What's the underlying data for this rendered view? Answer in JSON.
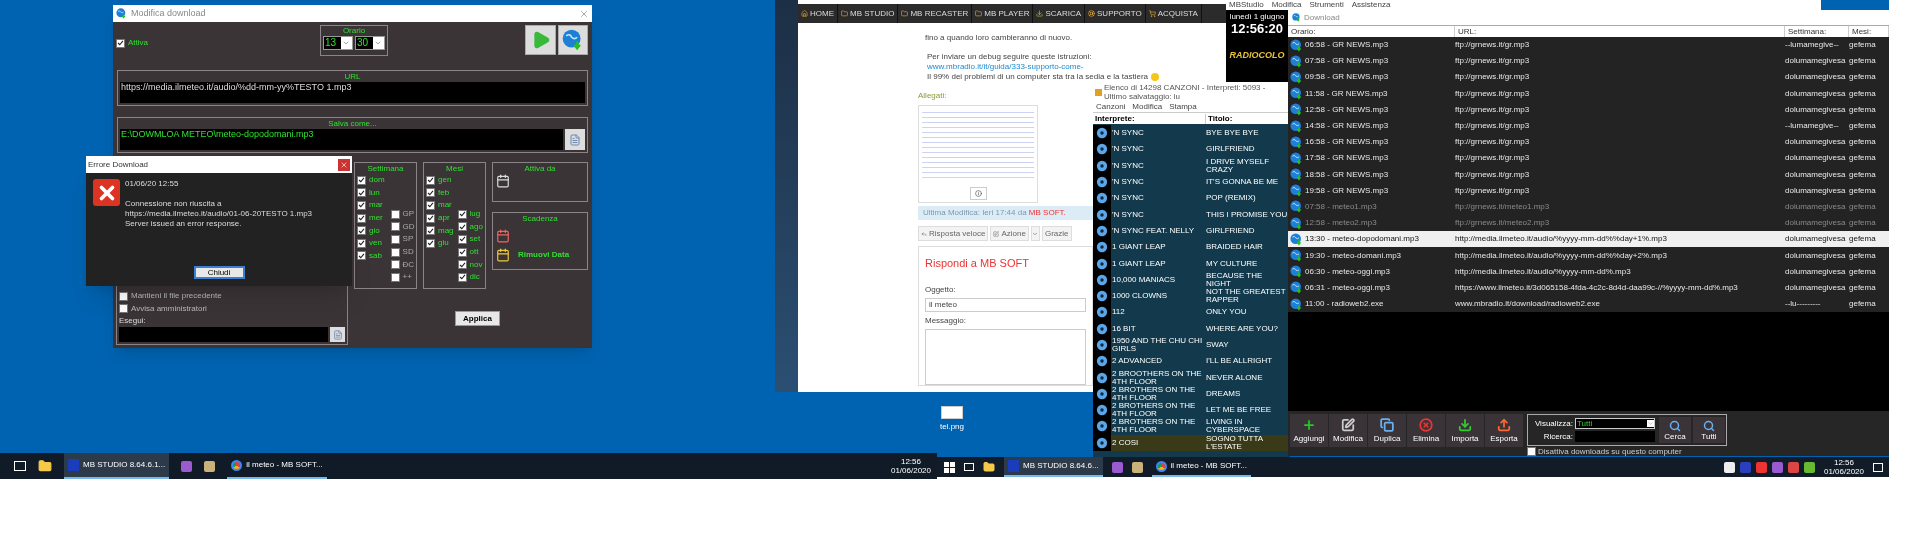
{
  "edit_dialog": {
    "title": "Modifica download",
    "active": {
      "label": "Attiva",
      "checked": true
    },
    "schedule": {
      "label": "Orario",
      "hour": "13",
      "minute": "30"
    },
    "url": {
      "label": "URL",
      "value": "https://media.ilmeteo.it/audio/%dd-mm-yy%TESTO 1.mp3"
    },
    "save_as": {
      "label": "Salva come...",
      "value": "E:\\DOWMLOA METEO\\meteo-dopodomani.mp3"
    },
    "failure_options": [
      {
        "label": "Mantieni il file precedente",
        "checked": false
      },
      {
        "label": "Avvisa amministratori",
        "checked": false
      }
    ],
    "run_label": "Esegui:",
    "week": {
      "label": "Settimana",
      "days": [
        {
          "label": "dom",
          "checked": true
        },
        {
          "label": "lun",
          "checked": true
        },
        {
          "label": "mar",
          "checked": true
        },
        {
          "label": "mer",
          "checked": true
        },
        {
          "label": "gio",
          "checked": true
        },
        {
          "label": "ven",
          "checked": true
        },
        {
          "label": "sab",
          "checked": true
        }
      ],
      "special": [
        {
          "label": "GP",
          "checked": false
        },
        {
          "label": "GD",
          "checked": false
        },
        {
          "label": "SP",
          "checked": false
        },
        {
          "label": "SD",
          "checked": false
        },
        {
          "label": "ÐC",
          "checked": false
        },
        {
          "label": "++",
          "checked": false
        }
      ]
    },
    "months": {
      "label": "Mesi",
      "items": [
        {
          "label": "gen",
          "checked": true
        },
        {
          "label": "feb",
          "checked": true
        },
        {
          "label": "mar",
          "checked": true
        },
        {
          "label": "apr",
          "checked": true
        },
        {
          "label": "mag",
          "checked": true
        },
        {
          "label": "giu",
          "checked": true
        },
        {
          "label": "lug",
          "checked": true
        },
        {
          "label": "ago",
          "checked": true
        },
        {
          "label": "set",
          "checked": true
        },
        {
          "label": "ott",
          "checked": true
        },
        {
          "label": "nov",
          "checked": true
        },
        {
          "label": "dic",
          "checked": true
        }
      ]
    },
    "active_from": {
      "label": "Attiva da"
    },
    "expiry": {
      "label": "Scadenza",
      "remove": "Rimuovi Data"
    },
    "apply": "Applica"
  },
  "error_dialog": {
    "title": "Errore Download",
    "timestamp": "01/06/20 12:55",
    "message": [
      "Connessione non riuscita a",
      "https://media.ilmeteo.it/audio/01-06-20TESTO 1.mp3",
      "Server issued an error response."
    ],
    "button": "Chiudi"
  },
  "left_taskbar": {
    "tasks": [
      {
        "label": "MB STUDIO 8.64.6.1...",
        "selected": true
      },
      {
        "label": "il meteo - MB SOFT...",
        "selected": false
      }
    ],
    "clock": {
      "time": "12:56",
      "date": "01/06/2020"
    }
  },
  "forum_page": {
    "nav": [
      "HOME",
      "MB STUDIO",
      "MB RECASTER",
      "MB PLAYER",
      "SCARICA",
      "SUPPORTO",
      "ACQUISTA"
    ],
    "post_text": "fino a quando loro cambieranno di nuovo.",
    "debug_text": "Per inviare un debug seguire queste istruzioni:",
    "debug_link": "www.mbradio.it/it/guida/333-supporto-come-",
    "signature": "Il 99% dei problemi di un computer sta tra la sedia e la tastiera",
    "attachments_label": "Allegati:",
    "last_edit": "Ultima Modifica: Ieri 17:44 da",
    "last_edit_author": "MB SOFT.",
    "actions": [
      "Risposta veloce",
      "Azione",
      "Grazie"
    ],
    "reply_title": "Rispondi a",
    "reply_author": "MB SOFT",
    "subject_label": "Oggetto:",
    "subject_value": "il meteo",
    "message_label": "Messaggio:"
  },
  "desktop_icon": {
    "label": "tel.png"
  },
  "studio_panel": {
    "menu": [
      "MBStudio",
      "Modifica",
      "Strumenti",
      "Assistenza"
    ],
    "date": "lunedì 1 giugno",
    "time": "12:56:20",
    "logo": "RADIOCOLO"
  },
  "song_list": {
    "title": "Elenco di 14298 CANZONI - Interpreti: 5093 - Ultimo salvataggio: lu",
    "menu": [
      "Canzoni",
      "Modifica",
      "Stampa"
    ],
    "columns": [
      "Interprete:",
      "Titolo:"
    ],
    "rows": [
      {
        "artist": "'N SYNC",
        "title": "BYE BYE BYE",
        "selected": false
      },
      {
        "artist": "'N SYNC",
        "title": "GIRLFRIEND",
        "selected": false
      },
      {
        "artist": "'N SYNC",
        "title": "I DRIVE MYSELF CRAZY",
        "selected": false
      },
      {
        "artist": "'N SYNC",
        "title": "IT'S GONNA BE ME",
        "selected": false
      },
      {
        "artist": "'N SYNC",
        "title": "POP          (REMIX)",
        "selected": false
      },
      {
        "artist": "'N SYNC",
        "title": "THIS I PROMISE YOU",
        "selected": false
      },
      {
        "artist": "'N SYNC FEAT. NELLY",
        "title": "GIRLFRIEND",
        "selected": false
      },
      {
        "artist": "1 GIANT LEAP",
        "title": "BRAIDED HAIR",
        "selected": false
      },
      {
        "artist": "1 GIANT LEAP",
        "title": "MY CULTURE",
        "selected": false
      },
      {
        "artist": "10,000 MANIACS",
        "title": "BECAUSE THE NIGHT",
        "selected": false
      },
      {
        "artist": "1000 CLOWNS",
        "title": "NOT THE GREATEST RAPPER",
        "selected": false
      },
      {
        "artist": "112",
        "title": "ONLY YOU",
        "selected": false
      },
      {
        "artist": "16 BIT",
        "title": "WHERE ARE YOU?",
        "selected": false
      },
      {
        "artist": "1950 AND THE CHU CHI GIRLS",
        "title": "SWAY",
        "selected": false
      },
      {
        "artist": "2 ADVANCED",
        "title": "I'LL BE ALLRIGHT",
        "selected": false
      },
      {
        "artist": "2 BROOTHERS ON THE 4TH FLOOR",
        "title": "NEVER ALONE",
        "selected": false
      },
      {
        "artist": "2 BROTHERS ON THE 4TH FLOOR",
        "title": "DREAMS",
        "selected": false
      },
      {
        "artist": "2 BROTHERS ON THE 4TH FLOOR",
        "title": "LET ME BE FREE",
        "selected": false
      },
      {
        "artist": "2 BROTHERS ON THE 4TH FLOOR",
        "title": "LIVING IN CYBERSPACE",
        "selected": false
      },
      {
        "artist": "2 COSI",
        "title": "SOGNO TUTTA L'ESTATE",
        "selected": true
      }
    ]
  },
  "download_window": {
    "title": "Download",
    "columns": [
      "Orario:",
      "URL:",
      "Settimana:",
      "Mesi:"
    ],
    "rows": [
      {
        "name": "06:58 - GR NEWS.mp3",
        "url": "ftp://grnews.it/gr.mp3",
        "week": "--lumamegive--",
        "months": "gefema",
        "disabled": false,
        "selected": false
      },
      {
        "name": "07:58 - GR NEWS.mp3",
        "url": "ftp://grnews.it/gr.mp3",
        "week": "dolumamegivesa",
        "months": "gefema",
        "disabled": false,
        "selected": false
      },
      {
        "name": "09:58 - GR NEWS.mp3",
        "url": "ftp://grnews.it/gr.mp3",
        "week": "dolumamegivesa",
        "months": "gefema",
        "disabled": false,
        "selected": false
      },
      {
        "name": "11:58 - GR NEWS.mp3",
        "url": "ftp://grnews.it/gr.mp3",
        "week": "dolumamegivesa",
        "months": "gefema",
        "disabled": false,
        "selected": false
      },
      {
        "name": "12:58 - GR NEWS.mp3",
        "url": "ftp://grnews.it/gr.mp3",
        "week": "dolumamegivesa",
        "months": "gefema",
        "disabled": false,
        "selected": false
      },
      {
        "name": "14:58 - GR NEWS.mp3",
        "url": "ftp://grnews.it/gr.mp3",
        "week": "--lumamegive--",
        "months": "gefema",
        "disabled": false,
        "selected": false
      },
      {
        "name": "16:58 - GR NEWS.mp3",
        "url": "ftp://grnews.it/gr.mp3",
        "week": "dolumamegivesa",
        "months": "gefema",
        "disabled": false,
        "selected": false
      },
      {
        "name": "17:58 - GR NEWS.mp3",
        "url": "ftp://grnews.it/gr.mp3",
        "week": "dolumamegivesa",
        "months": "gefema",
        "disabled": false,
        "selected": false
      },
      {
        "name": "18:58 - GR NEWS.mp3",
        "url": "ftp://grnews.it/gr.mp3",
        "week": "dolumamegivesa",
        "months": "gefema",
        "disabled": false,
        "selected": false
      },
      {
        "name": "19:58 - GR NEWS.mp3",
        "url": "ftp://grnews.it/gr.mp3",
        "week": "dolumamegivesa",
        "months": "gefema",
        "disabled": false,
        "selected": false
      },
      {
        "name": "07:58 - meteo1.mp3",
        "url": "ftp://grnews.it/meteo1.mp3",
        "week": "dolumamegivesa",
        "months": "gefema",
        "disabled": true,
        "selected": false
      },
      {
        "name": "12:58 - meteo2.mp3",
        "url": "ftp://grnews.it/meteo2.mp3",
        "week": "dolumamegivesa",
        "months": "gefema",
        "disabled": true,
        "selected": false
      },
      {
        "name": "13:30 - meteo-dopodomani.mp3",
        "url": "http://media.ilmeteo.it/audio/%yyyy-mm-dd%%day+1%.mp3",
        "week": "dolumamegivesa",
        "months": "gefema",
        "disabled": false,
        "selected": true
      },
      {
        "name": "19:30 - meteo-domani.mp3",
        "url": "http://media.ilmeteo.it/audio/%yyyy-mm-dd%%day+2%.mp3",
        "week": "dolumamegivesa",
        "months": "gefema",
        "disabled": false,
        "selected": false
      },
      {
        "name": "06:30 - meteo-oggi.mp3",
        "url": "http://media.ilmeteo.it/audio/%yyyy-mm-dd%.mp3",
        "week": "dolumamegivesa",
        "months": "gefema",
        "disabled": false,
        "selected": false
      },
      {
        "name": "06:31 - meteo-oggi.mp3",
        "url": "https://www.ilmeteo.it/3d065158-4fda-4c2c-8d4d-daa99c-//%yyyy-mm-dd%.mp3",
        "week": "dolumamegivesa",
        "months": "gefema",
        "disabled": false,
        "selected": false
      },
      {
        "name": "11:00 - radioweb2.exe",
        "url": "www.mbradio.it/download/radioweb2.exe",
        "week": "--lu---------",
        "months": "gefema",
        "disabled": false,
        "selected": false
      }
    ],
    "toolbar": [
      "Aggiungi",
      "Modifica",
      "Duplica",
      "Elimina",
      "Importa",
      "Esporta"
    ],
    "view_label": "Visualizza:",
    "view_value": "Tutti",
    "search_label": "Ricerca:",
    "search_buttons": [
      "Cerca",
      "Tutti"
    ],
    "disable_downloads": {
      "label": "Disattiva downloads su questo computer",
      "checked": false
    }
  },
  "right_taskbar": {
    "tasks": [
      {
        "label": "MB STUDIO 8.64.6...",
        "selected": true
      },
      {
        "label": "il meteo - MB SOFT...",
        "selected": false
      }
    ],
    "clock": {
      "time": "12:56",
      "date": "01/06/2020"
    }
  }
}
